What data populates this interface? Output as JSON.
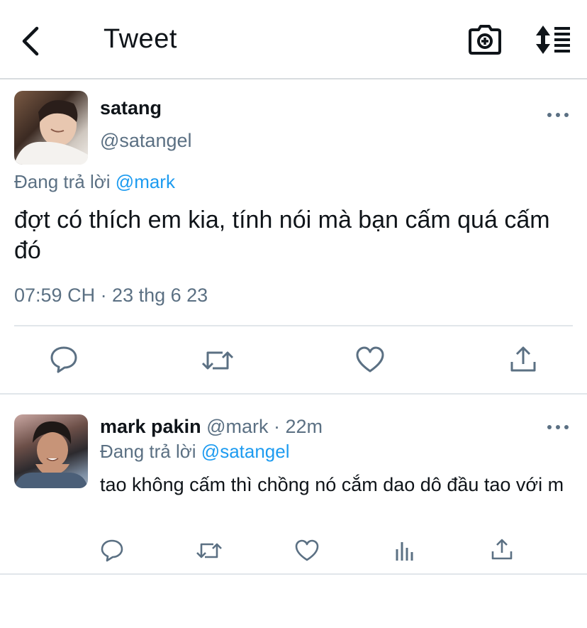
{
  "header": {
    "title": "Tweet",
    "back_icon": "chevron-left-icon",
    "camera_icon": "camera-add-icon",
    "sort_icon": "sort-list-icon"
  },
  "main_tweet": {
    "display_name": "satang",
    "handle": "@satangel",
    "replying_prefix": "Đang trả lời",
    "replying_mention": "@mark",
    "text": " đợt có thích em kia, tính nói mà bạn cấm quá cấm đó",
    "timestamp": "07:59 CH · 23 thg 6 23"
  },
  "reply_tweet": {
    "display_name": "mark pakin",
    "meta": "@mark · 22m",
    "replying_prefix": "Đang trả lời",
    "replying_mention": "@satangel",
    "text": " tao không cấm thì chồng nó cắm dao dô đầu tao với m"
  },
  "colors": {
    "text": "#0f1419",
    "secondary": "#5b7083",
    "link": "#1d9bf0",
    "divider": "#e1e6ea"
  }
}
